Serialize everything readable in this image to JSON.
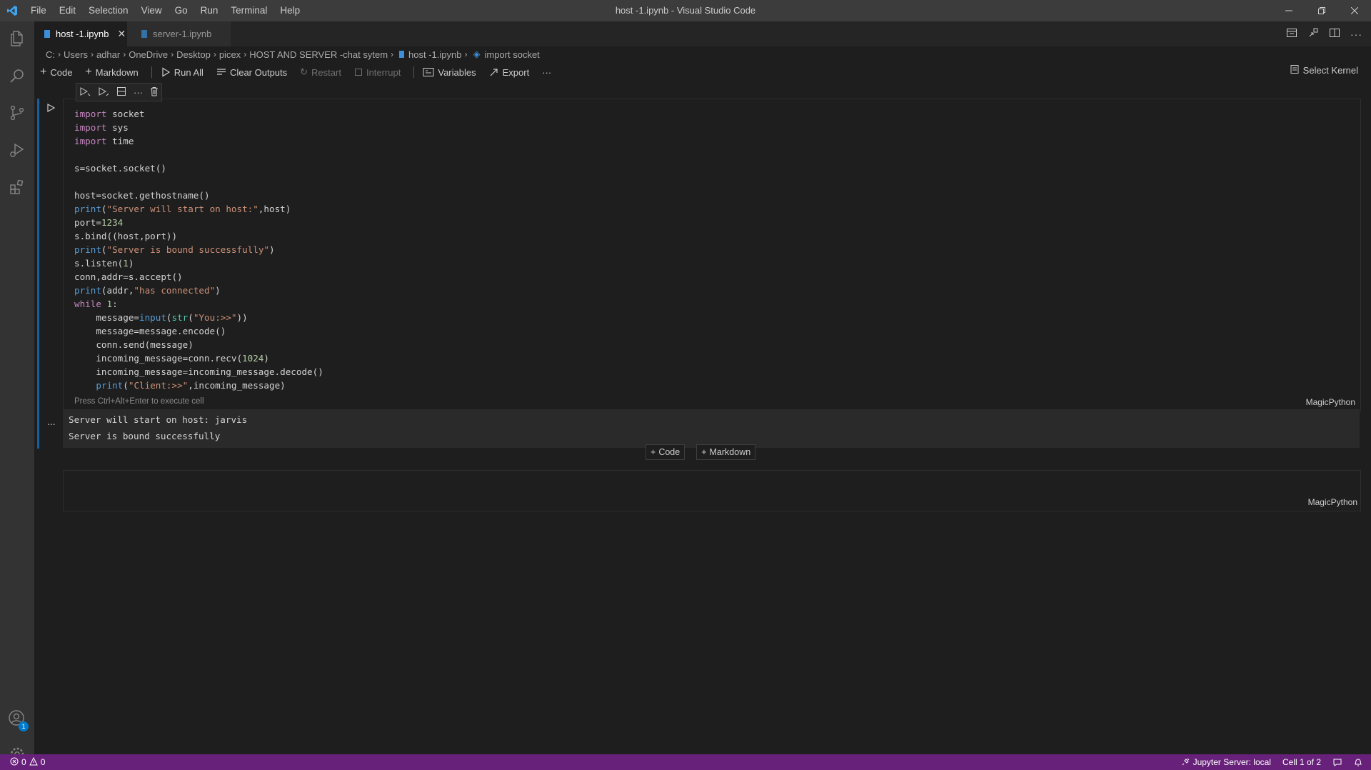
{
  "menu": [
    "File",
    "Edit",
    "Selection",
    "View",
    "Go",
    "Run",
    "Terminal",
    "Help"
  ],
  "window_title": "host -1.ipynb - Visual Studio Code",
  "tabs": [
    {
      "label": "host -1.ipynb",
      "active": true
    },
    {
      "label": "server-1.ipynb",
      "active": false
    }
  ],
  "breadcrumb": [
    "C:",
    "Users",
    "adhar",
    "OneDrive",
    "Desktop",
    "picex",
    "HOST AND SERVER -chat sytem",
    "host -1.ipynb",
    "import socket"
  ],
  "toolbar": {
    "code": "Code",
    "markdown": "Markdown",
    "run_all": "Run All",
    "clear_outputs": "Clear Outputs",
    "restart": "Restart",
    "interrupt": "Interrupt",
    "variables": "Variables",
    "export": "Export",
    "more": "···",
    "kernel": "Select Kernel"
  },
  "cell": {
    "hint": "Press Ctrl+Alt+Enter to execute cell",
    "language": "MagicPython",
    "output": [
      "Server will start on host: jarvis",
      "Server is bound successfully"
    ],
    "more": "..."
  },
  "add_buttons": {
    "code": "Code",
    "markdown": "Markdown"
  },
  "cell2": {
    "language": "MagicPython"
  },
  "activity_bar": {
    "accounts_badge": "1"
  },
  "status": {
    "errors": "0",
    "warnings": "0",
    "jupyter": "Jupyter Server: local",
    "cell_position": "Cell 1 of 2"
  },
  "colors": {
    "status_bar": "#68217a",
    "accent": "#0e639c",
    "keyword": "#c586c0",
    "string": "#ce9178"
  }
}
